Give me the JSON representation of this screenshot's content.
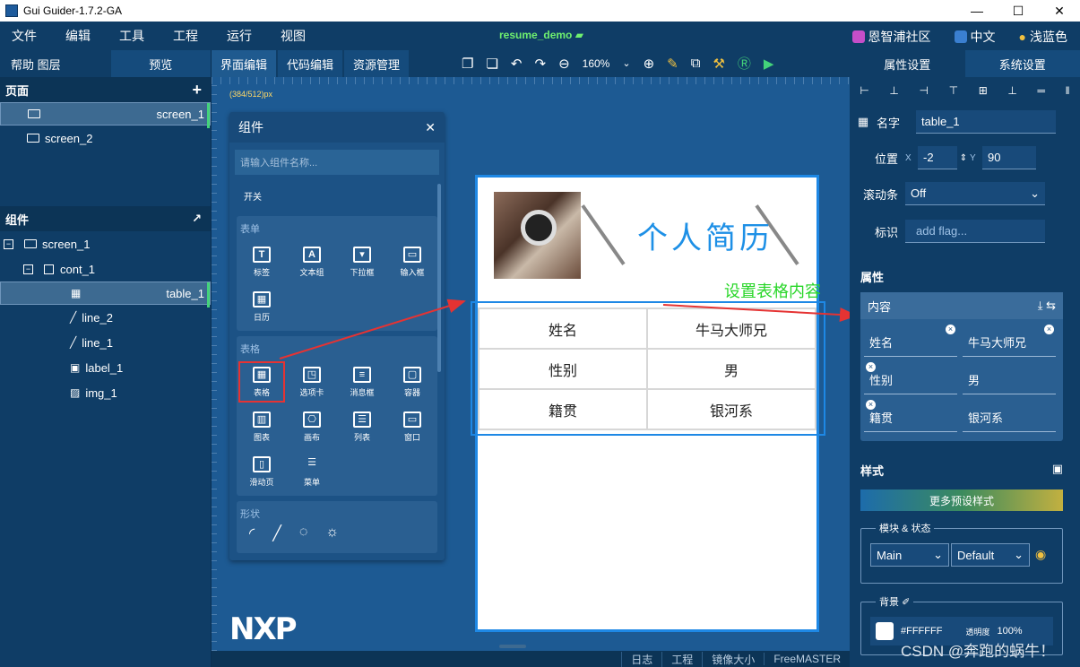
{
  "window": {
    "title": "Gui Guider-1.7.2-GA",
    "minimize": "—",
    "maximize": "☐",
    "close": "✕"
  },
  "menu": {
    "items": [
      "文件",
      "编辑",
      "工具",
      "工程",
      "运行",
      "视图"
    ],
    "project": "resume_demo",
    "community": "恩智浦社区",
    "language": "中文",
    "theme": "浅蓝色"
  },
  "left_panel": {
    "tabs": [
      "帮助 图层",
      "预览"
    ],
    "pages_title": "页面",
    "screens": [
      "screen_1",
      "screen_2"
    ],
    "components_title": "组件",
    "tree": [
      {
        "label": "screen_1",
        "toggle": "−"
      },
      {
        "label": "cont_1",
        "toggle": "−"
      },
      {
        "label": "table_1"
      },
      {
        "label": "line_2"
      },
      {
        "label": "line_1"
      },
      {
        "label": "label_1"
      },
      {
        "label": "img_1"
      }
    ]
  },
  "center": {
    "tabs": [
      "界面编辑",
      "代码编辑",
      "资源管理"
    ],
    "zoom": "160%",
    "coord_readout": "(384/512)px",
    "status_items": [
      "日志",
      "工程",
      "镜像大小",
      "FreeMASTER"
    ]
  },
  "palette": {
    "title": "组件",
    "search_placeholder": "请输入组件名称...",
    "top_item": "开关",
    "sections": [
      {
        "title": "表单",
        "items": [
          "标签",
          "文本组",
          "下拉框",
          "输入框",
          "日历"
        ]
      },
      {
        "title": "表格",
        "items": [
          "表格",
          "选项卡",
          "消息框",
          "容器",
          "图表",
          "画布",
          "列表",
          "窗口",
          "滑动页",
          "菜单"
        ]
      },
      {
        "title": "形状",
        "items": []
      }
    ]
  },
  "screen_preview": {
    "title": "个人简历",
    "table": [
      [
        "姓名",
        "牛马大师兄"
      ],
      [
        "性别",
        "男"
      ],
      [
        "籍贯",
        "银河系"
      ]
    ]
  },
  "annotation": "设置表格内容",
  "logo": "NXP",
  "right_panel": {
    "tabs": [
      "属性设置",
      "系统设置"
    ],
    "name_label": "名字",
    "name_value": "table_1",
    "position_label": "位置",
    "x_label": "X",
    "x_value": "-2",
    "y_label": "Y",
    "y_value": "90",
    "scrollbar_label": "滚动条",
    "scrollbar_value": "Off",
    "flag_label": "标识",
    "flag_placeholder": "add flag...",
    "attrs_title": "属性",
    "content_title": "内容",
    "cells": [
      "姓名",
      "牛马大师兄",
      "性别",
      "男",
      "籍贯",
      "银河系"
    ],
    "style_title": "样式",
    "presets_label": "更多预设样式",
    "module_legend": "模块 & 状态",
    "module_value": "Main",
    "state_value": "Default",
    "bg_legend": "背景",
    "bg_color": "#FFFFFF",
    "opacity_label": "透明度",
    "opacity_value": "100%"
  },
  "watermark": "CSDN @奔跑的蜗牛！",
  "colors": {
    "accent": "#1e88e5",
    "highlight": "#e53333",
    "annotation": "#28d628",
    "bg": "#0f3d66"
  }
}
